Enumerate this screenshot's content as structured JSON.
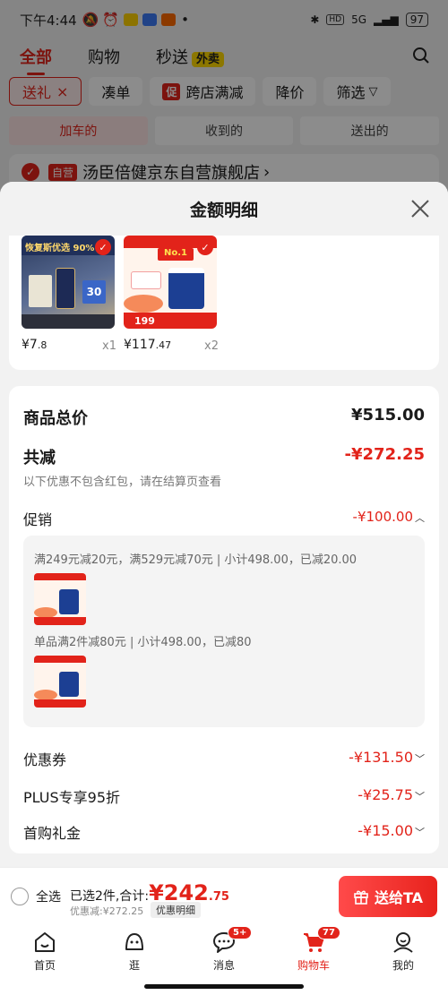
{
  "status_bar": {
    "time": "下午4:44",
    "network": "5G",
    "battery": "97"
  },
  "top_nav": {
    "tabs": [
      "全部",
      "购物",
      "秒送"
    ],
    "waimai_badge": "外卖"
  },
  "filters": {
    "chips": [
      "送礼",
      "凑单",
      "跨店满减",
      "降价",
      "筛选"
    ],
    "cu_tag": "促",
    "close_mark": "×"
  },
  "segments": [
    "加车的",
    "收到的",
    "送出的"
  ],
  "store": {
    "tag": "自营",
    "name": "汤臣倍健京东自营旗舰店",
    "arrow": "›"
  },
  "sheet": {
    "title": "金额明细"
  },
  "products": [
    {
      "banner": "恢复斯优选 90%",
      "price_main": "¥7",
      "price_dec": ".8",
      "qty": "x1",
      "thumb_label": "30"
    },
    {
      "banner": "No.1",
      "price_main": "¥117",
      "price_dec": ".47",
      "qty": "x2",
      "thumb_label": "199"
    }
  ],
  "summary": {
    "total_label": "商品总价",
    "total_value": "¥515.00",
    "reduce_label": "共减",
    "reduce_value": "-¥272.25",
    "note": "以下优惠不包含红包，请在结算页查看",
    "promo_label": "促销",
    "promo_value": "-¥100.00",
    "promo_lines": [
      "满249元减20元，满529元减70元 | 小计498.00，已减20.00",
      "单品满2件减80元 | 小计498.00，已减80"
    ],
    "coupon_label": "优惠券",
    "coupon_value": "-¥131.50",
    "plus_label": "PLUS专享95折",
    "plus_value": "-¥25.75",
    "first_label": "首购礼金",
    "first_value": "-¥15.00"
  },
  "bottom": {
    "select_all": "全选",
    "selected": "已选2件,合计:",
    "total_main": "¥242",
    "total_dec": ".75",
    "discount": "优惠减:¥272.25",
    "detail_btn": "优惠明细",
    "send_btn": "送给TA"
  },
  "tabbar": {
    "items": [
      "首页",
      "逛",
      "消息",
      "购物车",
      "我的"
    ],
    "msg_badge": "5+",
    "cart_badge": "77"
  },
  "colors": {
    "accent": "#e2231a"
  }
}
